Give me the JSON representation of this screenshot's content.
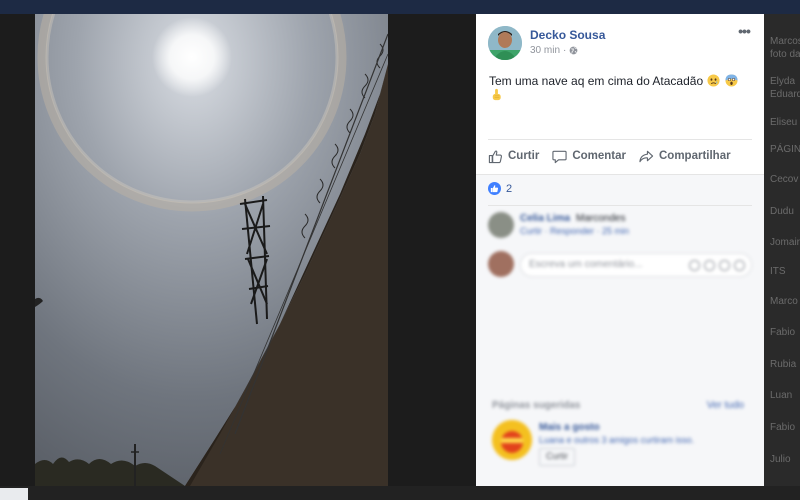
{
  "post": {
    "author": "Decko Sousa",
    "time": "30 min",
    "privacy_icon": "globe-icon",
    "text": "Tem uma nave aq em cima do Atacadão",
    "emojis": [
      "worried-face",
      "screaming-face",
      "pointing-up-hand"
    ]
  },
  "actions": {
    "like_label": "Curtir",
    "comment_label": "Comentar",
    "share_label": "Compartilhar"
  },
  "reactions": {
    "like_count": "2"
  },
  "comment": {
    "author": "Celia Lima",
    "body": "Marcondes",
    "meta": "Curtir · Responder · 25 min"
  },
  "reply": {
    "placeholder": "Escreva um comentário..."
  },
  "suggested": {
    "title": "Páginas sugeridas",
    "see_all": "Ver tudo",
    "page_name": "Mais a gosto",
    "page_sub": "Luana e outros 3 amigos curtiram isso.",
    "like_button": "Curtir"
  },
  "background_sidebar": {
    "items": [
      "Marcos",
      "foto da",
      "Elyda",
      "Eduard",
      "Eliseu",
      "PÁGINA",
      "Cecov",
      "Dudu",
      "Jomair",
      "ITS",
      "Marco",
      "Fabio",
      "Rubia",
      "Luan",
      "Fabio",
      "Julio"
    ]
  },
  "colors": {
    "link": "#365899",
    "accent": "#4080ff",
    "panel_bg": "#ffffff",
    "overlay_bg": "#1c1c1c"
  }
}
